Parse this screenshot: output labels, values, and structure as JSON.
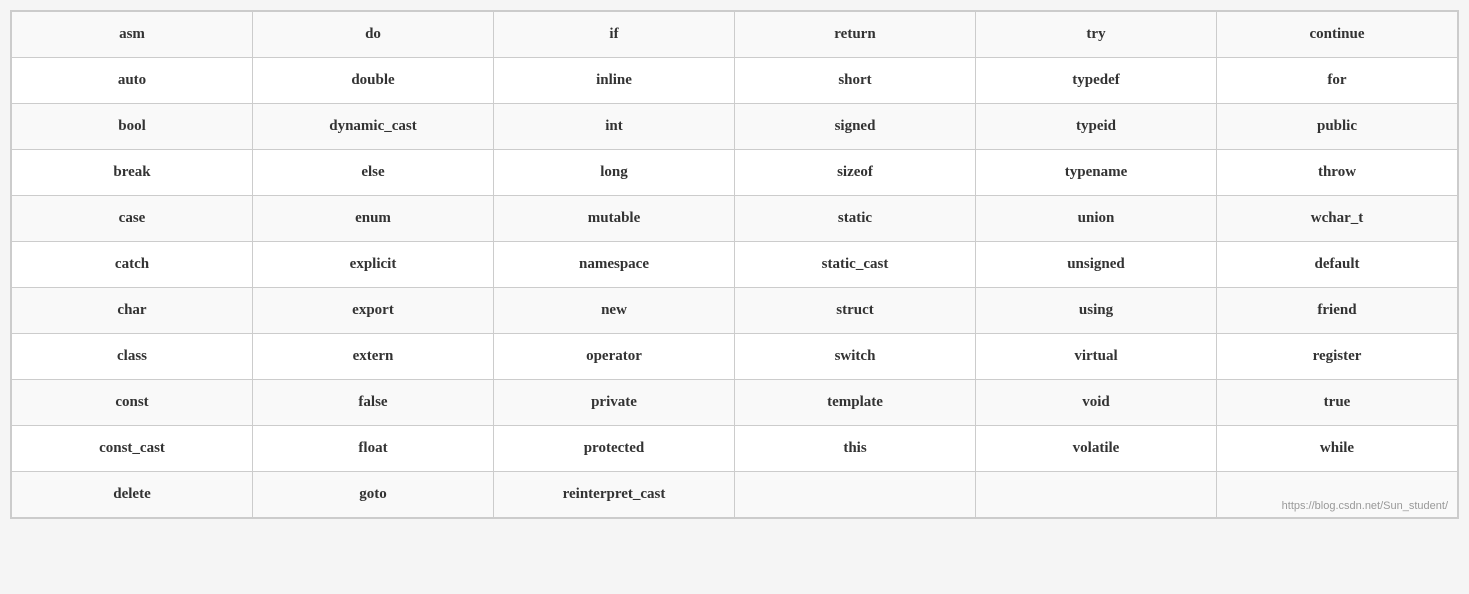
{
  "table": {
    "rows": [
      [
        "asm",
        "do",
        "if",
        "return",
        "try",
        "continue"
      ],
      [
        "auto",
        "double",
        "inline",
        "short",
        "typedef",
        "for"
      ],
      [
        "bool",
        "dynamic_cast",
        "int",
        "signed",
        "typeid",
        "public"
      ],
      [
        "break",
        "else",
        "long",
        "sizeof",
        "typename",
        "throw"
      ],
      [
        "case",
        "enum",
        "mutable",
        "static",
        "union",
        "wchar_t"
      ],
      [
        "catch",
        "explicit",
        "namespace",
        "static_cast",
        "unsigned",
        "default"
      ],
      [
        "char",
        "export",
        "new",
        "struct",
        "using",
        "friend"
      ],
      [
        "class",
        "extern",
        "operator",
        "switch",
        "virtual",
        "register"
      ],
      [
        "const",
        "false",
        "private",
        "template",
        "void",
        "true"
      ],
      [
        "const_cast",
        "float",
        "protected",
        "this",
        "volatile",
        "while"
      ],
      [
        "delete",
        "goto",
        "reinterpret_cast",
        "",
        "",
        ""
      ]
    ],
    "watermark": "https://blog.csdn.net/Sun_student/"
  }
}
